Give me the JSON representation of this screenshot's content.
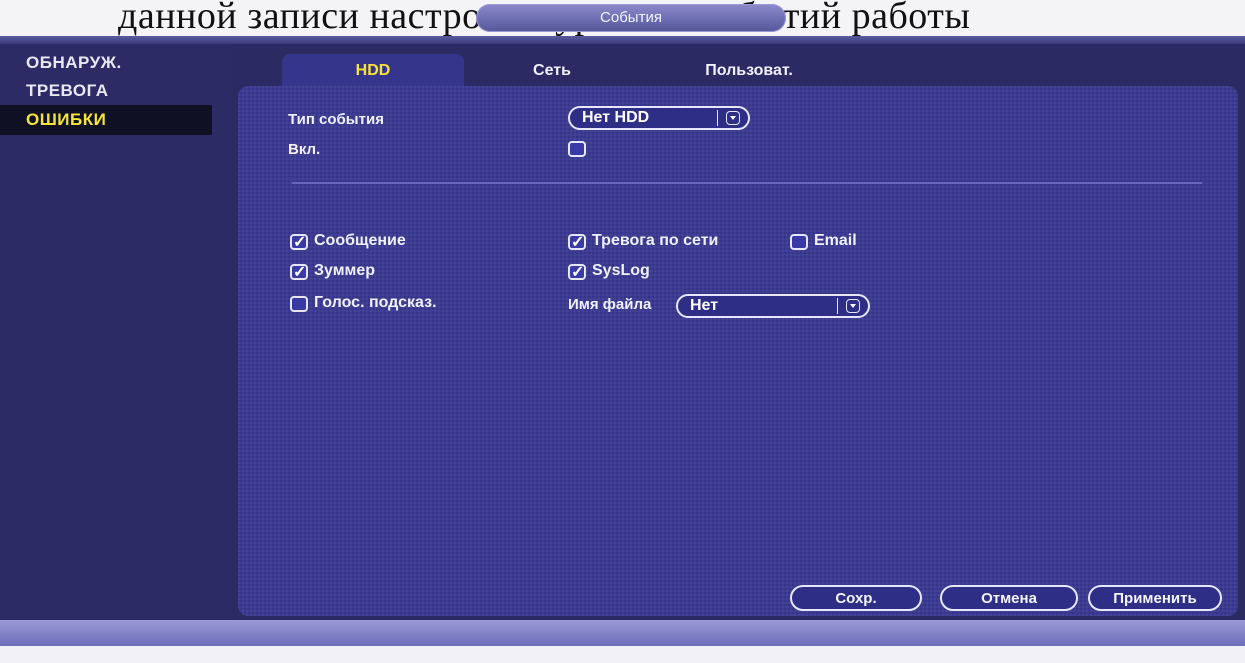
{
  "window": {
    "title": "События"
  },
  "doc_header_fragment": "данной записи настроек журналов событий работы",
  "sidebar": {
    "items": [
      {
        "label": "ОБНАРУЖ."
      },
      {
        "label": "ТРЕВОГА"
      },
      {
        "label": "ОШИБКИ",
        "active": true
      }
    ]
  },
  "tabs": [
    {
      "label": "HDD",
      "active": true
    },
    {
      "label": "Сеть"
    },
    {
      "label": "Пользоват."
    }
  ],
  "form": {
    "event_type_label": "Тип события",
    "event_type_value": "Нет HDD",
    "enable_label": "Вкл.",
    "message_label": "Сообщение",
    "net_alarm_label": "Тревога по сети",
    "email_label": "Email",
    "buzzer_label": "Зуммер",
    "syslog_label": "SysLog",
    "voice_prompt_label": "Голос. подсказ.",
    "filename_label": "Имя файла",
    "filename_value": "Нет"
  },
  "buttons": {
    "save": "Сохр.",
    "cancel": "Отмена",
    "apply": "Применить"
  },
  "colors": {
    "active_text": "#f5e43a",
    "panel": "#36358c"
  }
}
